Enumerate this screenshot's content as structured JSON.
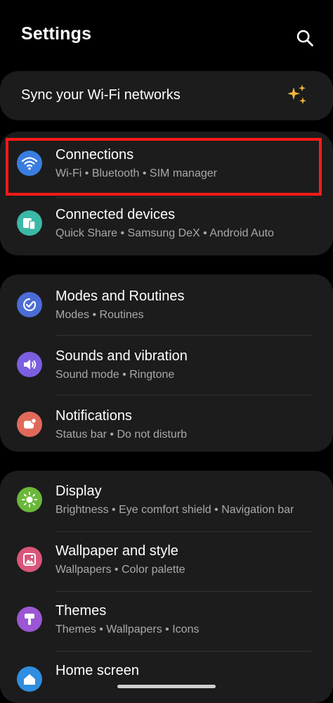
{
  "header": {
    "title": "Settings"
  },
  "sync": {
    "label": "Sync your Wi-Fi networks"
  },
  "groups": [
    {
      "items": [
        {
          "label": "Connections",
          "sub": [
            "Wi-Fi",
            "Bluetooth",
            "SIM manager"
          ],
          "icon": "wifi-icon",
          "color": "#3a7de0"
        },
        {
          "label": "Connected devices",
          "sub": [
            "Quick Share",
            "Samsung DeX",
            "Android Auto"
          ],
          "icon": "devices-icon",
          "color": "#3bb8a6"
        }
      ]
    },
    {
      "items": [
        {
          "label": "Modes and Routines",
          "sub": [
            "Modes",
            "Routines"
          ],
          "icon": "routines-icon",
          "color": "#4b6cd6"
        },
        {
          "label": "Sounds and vibration",
          "sub": [
            "Sound mode",
            "Ringtone"
          ],
          "icon": "speaker-icon",
          "color": "#7b5fe0"
        },
        {
          "label": "Notifications",
          "sub": [
            "Status bar",
            "Do not disturb"
          ],
          "icon": "notification-icon",
          "color": "#e06a5a"
        }
      ]
    },
    {
      "items": [
        {
          "label": "Display",
          "sub": [
            "Brightness",
            "Eye comfort shield",
            "Navigation bar"
          ],
          "icon": "brightness-icon",
          "color": "#6ab83a"
        },
        {
          "label": "Wallpaper and style",
          "sub": [
            "Wallpapers",
            "Color palette"
          ],
          "icon": "wallpaper-icon",
          "color": "#d9567a"
        },
        {
          "label": "Themes",
          "sub": [
            "Themes",
            "Wallpapers",
            "Icons"
          ],
          "icon": "themes-icon",
          "color": "#9b57d3"
        },
        {
          "label": "Home screen",
          "sub": [],
          "icon": "home-icon",
          "color": "#2f8ee0"
        }
      ]
    }
  ],
  "colors": {
    "highlight": "#ff1a1a",
    "sparkle": "#f2b53a",
    "background": "#000000",
    "card": "#1c1c1c"
  }
}
